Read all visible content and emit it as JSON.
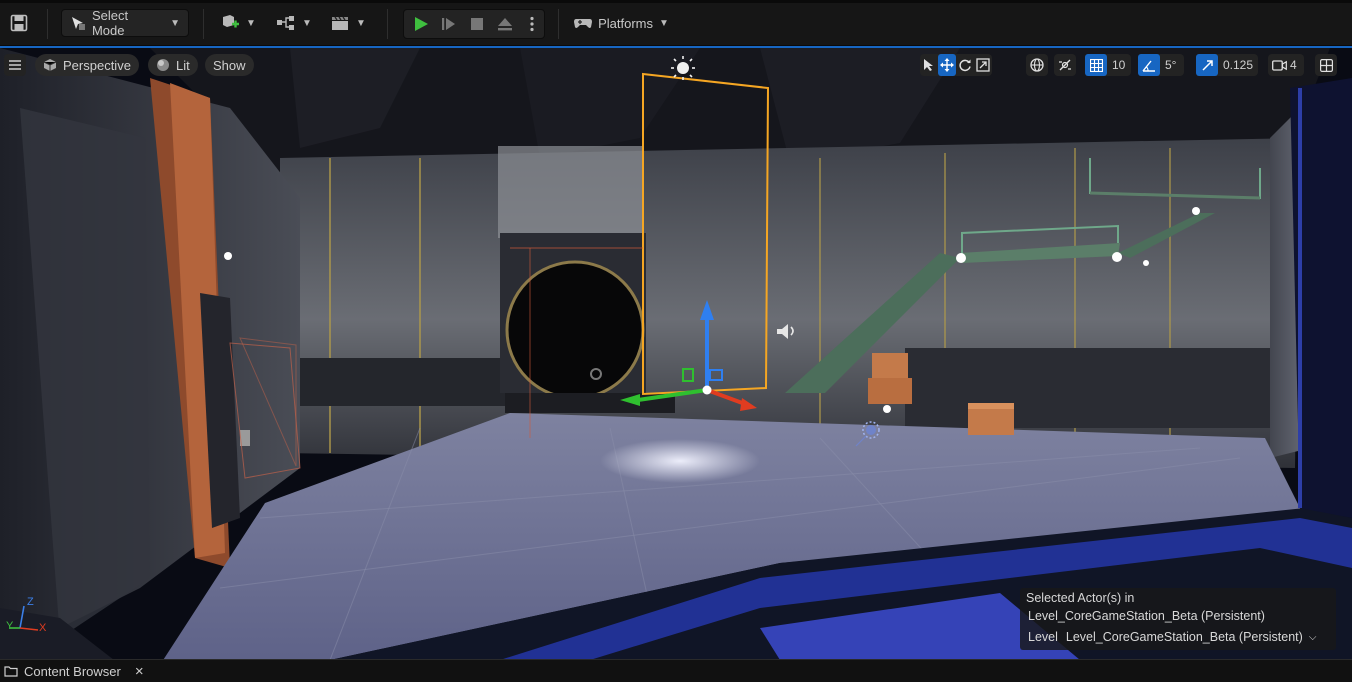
{
  "toolbar": {
    "select_mode_label": "Select Mode",
    "platforms_label": "Platforms"
  },
  "viewport": {
    "perspective_label": "Perspective",
    "lit_label": "Lit",
    "show_label": "Show",
    "grid_snap_value": "10",
    "rotation_snap_value": "5°",
    "scale_snap_value": "0.125",
    "camera_speed_value": "4",
    "axis_labels": {
      "z": "Z",
      "y": "Y",
      "x": "X"
    }
  },
  "selection_panel": {
    "line1": "Selected Actor(s) in",
    "line2": "Level_CoreGameStation_Beta (Persistent)",
    "level_label": "Level",
    "level_value": "Level_CoreGameStation_Beta (Persistent)"
  },
  "bottom_bar": {
    "content_browser_label": "Content Browser",
    "close_glyph": "×"
  },
  "colors": {
    "accent": "#1766c2",
    "play_green": "#3fbf3f",
    "selection_orange": "#f5a623",
    "gizmo_blue": "#2f7ff0",
    "gizmo_green": "#2fbf2f",
    "gizmo_red": "#e03c20"
  }
}
